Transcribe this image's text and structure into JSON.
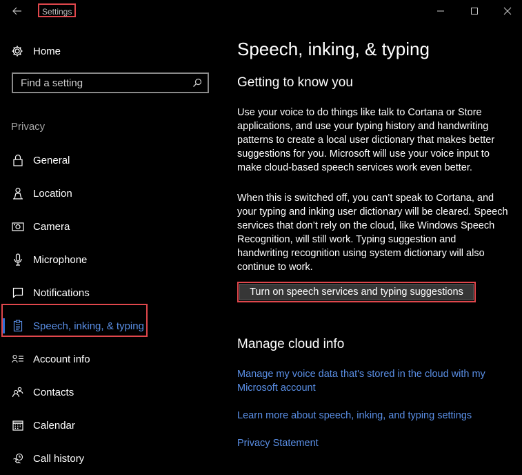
{
  "window": {
    "title": "Settings",
    "colors": {
      "accent": "#5a8fe6",
      "highlight": "#e0474c",
      "background": "#000000"
    }
  },
  "sidebar": {
    "home_label": "Home",
    "search_placeholder": "Find a setting",
    "section_heading": "Privacy",
    "items": [
      {
        "label": "General",
        "icon": "lock-icon"
      },
      {
        "label": "Location",
        "icon": "person-pin-icon"
      },
      {
        "label": "Camera",
        "icon": "camera-icon"
      },
      {
        "label": "Microphone",
        "icon": "microphone-icon"
      },
      {
        "label": "Notifications",
        "icon": "notification-icon"
      },
      {
        "label": "Speech, inking, & typing",
        "icon": "clipboard-icon",
        "active": true
      },
      {
        "label": "Account info",
        "icon": "account-info-icon"
      },
      {
        "label": "Contacts",
        "icon": "contacts-icon"
      },
      {
        "label": "Calendar",
        "icon": "calendar-icon"
      },
      {
        "label": "Call history",
        "icon": "call-history-icon"
      }
    ]
  },
  "main": {
    "title": "Speech, inking, & typing",
    "getting_to_know": {
      "heading": "Getting to know you",
      "para1": "Use your voice to do things like talk to Cortana or Store applications, and use your typing history and handwriting patterns to create a local user dictionary that makes better suggestions for you. Microsoft will use your voice input to make cloud-based speech services work even better.",
      "para2": "When this is switched off, you can’t speak to Cortana, and your typing and inking user dictionary will be cleared. Speech services that don’t rely on the cloud, like Windows Speech Recognition, will still work. Typing suggestion and handwriting recognition using system dictionary will also continue to work.",
      "button_label": "Turn on speech services and typing suggestions"
    },
    "manage_cloud": {
      "heading": "Manage cloud info",
      "link1": "Manage my voice data that's stored in the cloud with my Microsoft account",
      "link2": "Learn more about speech, inking, and typing settings",
      "link3": "Privacy Statement"
    }
  }
}
